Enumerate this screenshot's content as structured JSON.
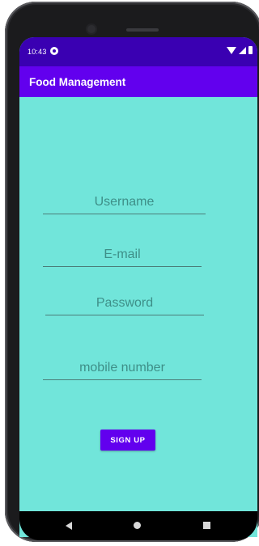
{
  "status_bar": {
    "time": "10:43",
    "icons": [
      "notification-icon",
      "wifi-icon",
      "signal-icon",
      "battery-icon"
    ]
  },
  "app_bar": {
    "title": "Food Management",
    "color": "#6200ee"
  },
  "form": {
    "username_placeholder": "Username",
    "email_placeholder": "E-mail",
    "password_placeholder": "Password",
    "mobile_placeholder": "mobile number",
    "signup_label": "SIGN UP"
  },
  "nav_bar": {
    "icons": [
      "back-icon",
      "home-icon",
      "recents-icon"
    ]
  },
  "colors": {
    "background": "#71e5da",
    "primary": "#6200ee",
    "status_bar": "#3a00b2"
  }
}
